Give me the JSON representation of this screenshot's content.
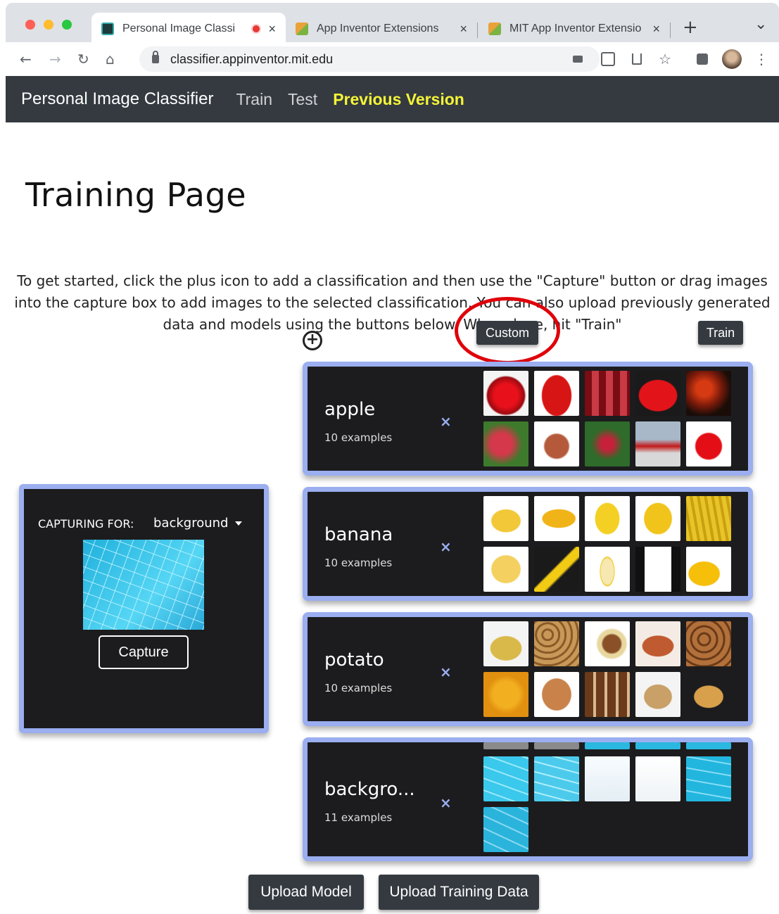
{
  "browser": {
    "tabs": [
      {
        "title": "Personal Image Classi",
        "close": "×"
      },
      {
        "title": "App Inventor Extensions",
        "close": "×"
      },
      {
        "title": "MIT App Inventor Extensio",
        "close": "×"
      }
    ],
    "new_tab": "+",
    "tab_menu": "⌄",
    "url": "classifier.appinventor.mit.edu",
    "icons": {
      "back": "←",
      "forward": "→",
      "reload": "↻",
      "home": "⌂",
      "menu": "⋮",
      "star": "☆"
    }
  },
  "nav": {
    "brand": "Personal Image Classifier",
    "links": [
      "Train",
      "Test",
      "Previous Version"
    ]
  },
  "page": {
    "title": "Training Page",
    "intro": "To get started, click the plus icon to add a classification and then use the \"Capture\" button or drag images into the capture box to add images to the selected classification. You can also upload previously generated data and models using the buttons below. When done, hit \"Train\"",
    "custom_label": "Custom",
    "train_label": "Train",
    "add_icon": "+"
  },
  "classes": [
    {
      "name": "apple",
      "count": "10 examples",
      "remove": "×"
    },
    {
      "name": "banana",
      "count": "10 examples",
      "remove": "×"
    },
    {
      "name": "potato",
      "count": "10 examples",
      "remove": "×"
    },
    {
      "name": "backgro...",
      "count": "11 examples",
      "remove": "×"
    }
  ],
  "capture": {
    "label": "CAPTURING FOR:",
    "selected": "background",
    "button": "Capture"
  },
  "footer": {
    "upload_model": "Upload Model",
    "upload_data": "Upload Training Data"
  },
  "colors": {
    "nav_bg": "#343a40",
    "panel_bg": "#1c1c1e",
    "panel_border": "#9aaef0",
    "highlight_link": "#f5f537",
    "ring": "#e0000a"
  }
}
